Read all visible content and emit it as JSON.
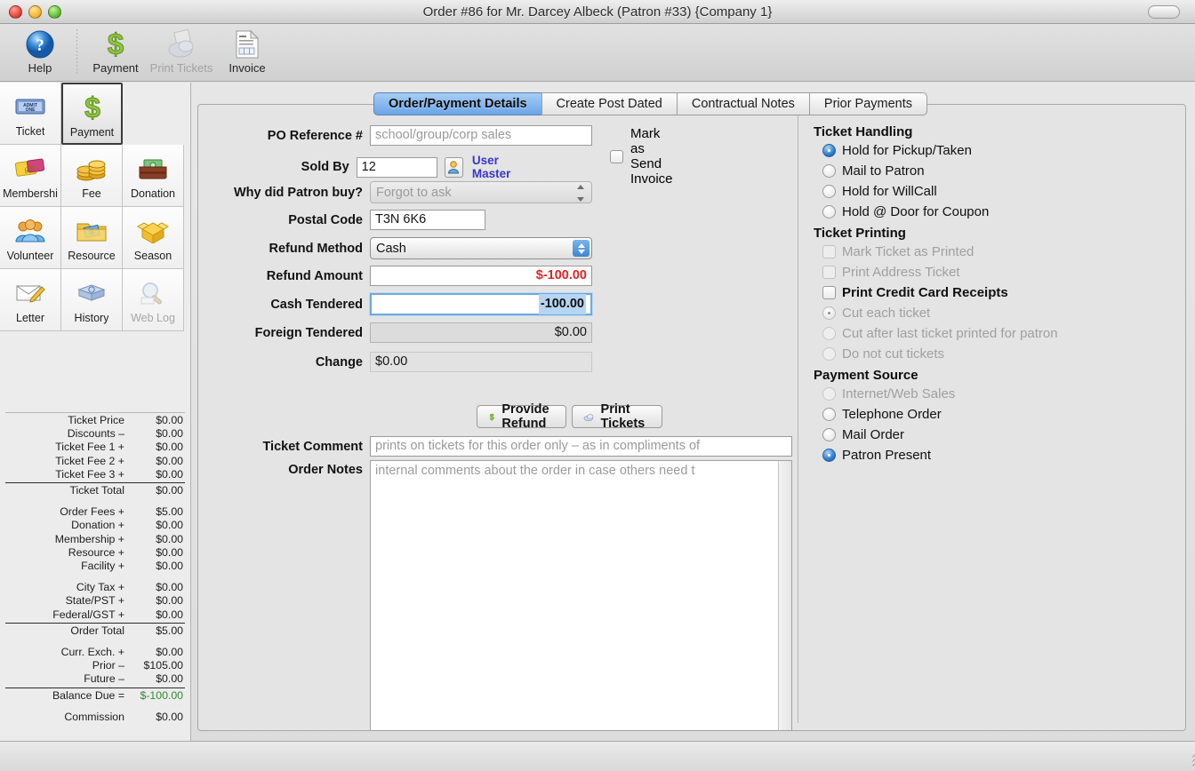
{
  "window": {
    "title": "Order #86 for Mr. Darcey Albeck (Patron #33) {Company 1}"
  },
  "toolbar": {
    "items": [
      {
        "label": "Help",
        "icon": "help-icon",
        "disabled": false
      },
      {
        "label": "Payment",
        "icon": "dollar-icon",
        "disabled": false
      },
      {
        "label": "Print Tickets",
        "icon": "printer-icon",
        "disabled": true
      },
      {
        "label": "Invoice",
        "icon": "document-icon",
        "disabled": false
      }
    ]
  },
  "sidebar": {
    "items": [
      {
        "label": "Ticket",
        "icon": "ticket-icon",
        "selected": false,
        "disabled": false
      },
      {
        "label": "Payment",
        "icon": "dollar-icon",
        "selected": true,
        "disabled": false
      },
      {
        "label": "Membershi",
        "icon": "giftcard-icon",
        "selected": false,
        "disabled": false
      },
      {
        "label": "Fee",
        "icon": "coins-icon",
        "selected": false,
        "disabled": false
      },
      {
        "label": "Donation",
        "icon": "money-wallet-icon",
        "selected": false,
        "disabled": false
      },
      {
        "label": "Volunteer",
        "icon": "people-icon",
        "selected": false,
        "disabled": false
      },
      {
        "label": "Resource",
        "icon": "folder-money-icon",
        "selected": false,
        "disabled": false
      },
      {
        "label": "Season",
        "icon": "open-box-icon",
        "selected": false,
        "disabled": false
      },
      {
        "label": "Letter",
        "icon": "envelope-pencil-icon",
        "selected": false,
        "disabled": false
      },
      {
        "label": "History",
        "icon": "history-book-icon",
        "selected": false,
        "disabled": false
      },
      {
        "label": "Web Log",
        "icon": "magnifier-icon",
        "selected": false,
        "disabled": true
      }
    ]
  },
  "totals": {
    "rows": [
      {
        "label": "Ticket Price",
        "value": "$0.00",
        "rule": false,
        "gap": false
      },
      {
        "label": "Discounts –",
        "value": "$0.00",
        "rule": false,
        "gap": false
      },
      {
        "label": "Ticket Fee 1 +",
        "value": "$0.00",
        "rule": false,
        "gap": false
      },
      {
        "label": "Ticket Fee 2 +",
        "value": "$0.00",
        "rule": false,
        "gap": false
      },
      {
        "label": "Ticket Fee 3 +",
        "value": "$0.00",
        "rule": true,
        "gap": false
      },
      {
        "label": "Ticket Total",
        "value": "$0.00",
        "rule": false,
        "gap": true
      },
      {
        "label": "Order Fees +",
        "value": "$5.00",
        "rule": false,
        "gap": false
      },
      {
        "label": "Donation +",
        "value": "$0.00",
        "rule": false,
        "gap": false
      },
      {
        "label": "Membership +",
        "value": "$0.00",
        "rule": false,
        "gap": false
      },
      {
        "label": "Resource +",
        "value": "$0.00",
        "rule": false,
        "gap": false
      },
      {
        "label": "Facility +",
        "value": "$0.00",
        "rule": false,
        "gap": true
      },
      {
        "label": "City Tax +",
        "value": "$0.00",
        "rule": false,
        "gap": false
      },
      {
        "label": "State/PST +",
        "value": "$0.00",
        "rule": false,
        "gap": false
      },
      {
        "label": "Federal/GST +",
        "value": "$0.00",
        "rule": true,
        "gap": false
      },
      {
        "label": "Order Total",
        "value": "$5.00",
        "rule": false,
        "gap": true
      },
      {
        "label": "Curr. Exch. +",
        "value": "$0.00",
        "rule": false,
        "gap": false
      },
      {
        "label": "Prior –",
        "value": "$105.00",
        "rule": false,
        "gap": false
      },
      {
        "label": "Future –",
        "value": "$0.00",
        "rule": true,
        "gap": false
      },
      {
        "label": "Balance Due =",
        "value": "$-100.00",
        "rule": false,
        "gap": true,
        "green": true
      },
      {
        "label": "Commission",
        "value": "$0.00",
        "rule": false,
        "gap": false
      }
    ]
  },
  "tabs": [
    {
      "label": "Order/Payment Details",
      "active": true
    },
    {
      "label": "Create Post Dated",
      "active": false
    },
    {
      "label": "Contractual Notes",
      "active": false
    },
    {
      "label": "Prior Payments",
      "active": false
    }
  ],
  "form": {
    "po_reference_label": "PO Reference #",
    "po_reference_placeholder": "school/group/corp sales",
    "po_reference_value": "",
    "mark_send_invoice_label": "Mark as Send Invoice",
    "mark_send_invoice_checked": false,
    "sold_by_label": "Sold By",
    "sold_by_value": "12",
    "user_master_link": "User Master",
    "why_buy_label": "Why did Patron buy?",
    "why_buy_value": "Forgot to ask",
    "postal_code_label": "Postal Code",
    "postal_code_value": "T3N 6K6",
    "refund_method_label": "Refund Method",
    "refund_method_value": "Cash",
    "refund_amount_label": "Refund Amount",
    "refund_amount_value": "$-100.00",
    "cash_tendered_label": "Cash Tendered",
    "cash_tendered_value": "-100.00",
    "foreign_tendered_label": "Foreign Tendered",
    "foreign_tendered_value": "$0.00",
    "change_label": "Change",
    "change_value": "$0.00",
    "provide_refund_button": "Provide Refund",
    "print_tickets_button": "Print Tickets",
    "ticket_comment_label": "Ticket Comment",
    "ticket_comment_placeholder": "prints on tickets for this order only – as in compliments of",
    "order_notes_label": "Order Notes",
    "order_notes_placeholder": "internal comments about the order in case others need t"
  },
  "right_panel": {
    "ticket_handling": {
      "title": "Ticket Handling",
      "options": [
        {
          "label": "Hold for Pickup/Taken",
          "selected": true,
          "disabled": false
        },
        {
          "label": "Mail to Patron",
          "selected": false,
          "disabled": false
        },
        {
          "label": "Hold for WillCall",
          "selected": false,
          "disabled": false
        },
        {
          "label": "Hold @ Door for Coupon",
          "selected": false,
          "disabled": false
        }
      ]
    },
    "ticket_printing": {
      "title": "Ticket Printing",
      "checkboxes": [
        {
          "label": "Mark Ticket as Printed",
          "checked": false,
          "disabled": true
        },
        {
          "label": "Print Address Ticket",
          "checked": false,
          "disabled": true
        },
        {
          "label": "Print Credit Card Receipts",
          "checked": false,
          "disabled": false
        }
      ],
      "options": [
        {
          "label": "Cut each ticket",
          "selected": true,
          "disabled": true
        },
        {
          "label": "Cut after last ticket printed for patron",
          "selected": false,
          "disabled": true
        },
        {
          "label": "Do not cut tickets",
          "selected": false,
          "disabled": true
        }
      ]
    },
    "payment_source": {
      "title": "Payment Source",
      "options": [
        {
          "label": "Internet/Web Sales",
          "selected": false,
          "disabled": true
        },
        {
          "label": "Telephone Order",
          "selected": false,
          "disabled": false
        },
        {
          "label": "Mail Order",
          "selected": false,
          "disabled": false
        },
        {
          "label": "Patron Present",
          "selected": true,
          "disabled": false
        }
      ]
    }
  },
  "colors": {
    "accent_blue": "#3f85d0",
    "negative_red": "#e02424",
    "positive_green": "#2e8b2e",
    "link_purple": "#3a36c8"
  }
}
